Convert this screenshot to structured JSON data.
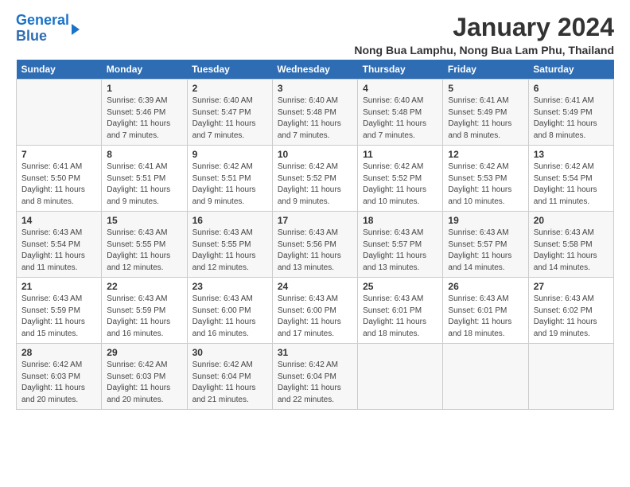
{
  "logo": {
    "line1": "General",
    "line2": "Blue"
  },
  "title": "January 2024",
  "location": "Nong Bua Lamphu, Nong Bua Lam Phu, Thailand",
  "weekdays": [
    "Sunday",
    "Monday",
    "Tuesday",
    "Wednesday",
    "Thursday",
    "Friday",
    "Saturday"
  ],
  "weeks": [
    [
      {
        "day": "",
        "info": ""
      },
      {
        "day": "1",
        "info": "Sunrise: 6:39 AM\nSunset: 5:46 PM\nDaylight: 11 hours\nand 7 minutes."
      },
      {
        "day": "2",
        "info": "Sunrise: 6:40 AM\nSunset: 5:47 PM\nDaylight: 11 hours\nand 7 minutes."
      },
      {
        "day": "3",
        "info": "Sunrise: 6:40 AM\nSunset: 5:48 PM\nDaylight: 11 hours\nand 7 minutes."
      },
      {
        "day": "4",
        "info": "Sunrise: 6:40 AM\nSunset: 5:48 PM\nDaylight: 11 hours\nand 7 minutes."
      },
      {
        "day": "5",
        "info": "Sunrise: 6:41 AM\nSunset: 5:49 PM\nDaylight: 11 hours\nand 8 minutes."
      },
      {
        "day": "6",
        "info": "Sunrise: 6:41 AM\nSunset: 5:49 PM\nDaylight: 11 hours\nand 8 minutes."
      }
    ],
    [
      {
        "day": "7",
        "info": "Sunrise: 6:41 AM\nSunset: 5:50 PM\nDaylight: 11 hours\nand 8 minutes."
      },
      {
        "day": "8",
        "info": "Sunrise: 6:41 AM\nSunset: 5:51 PM\nDaylight: 11 hours\nand 9 minutes."
      },
      {
        "day": "9",
        "info": "Sunrise: 6:42 AM\nSunset: 5:51 PM\nDaylight: 11 hours\nand 9 minutes."
      },
      {
        "day": "10",
        "info": "Sunrise: 6:42 AM\nSunset: 5:52 PM\nDaylight: 11 hours\nand 9 minutes."
      },
      {
        "day": "11",
        "info": "Sunrise: 6:42 AM\nSunset: 5:52 PM\nDaylight: 11 hours\nand 10 minutes."
      },
      {
        "day": "12",
        "info": "Sunrise: 6:42 AM\nSunset: 5:53 PM\nDaylight: 11 hours\nand 10 minutes."
      },
      {
        "day": "13",
        "info": "Sunrise: 6:42 AM\nSunset: 5:54 PM\nDaylight: 11 hours\nand 11 minutes."
      }
    ],
    [
      {
        "day": "14",
        "info": "Sunrise: 6:43 AM\nSunset: 5:54 PM\nDaylight: 11 hours\nand 11 minutes."
      },
      {
        "day": "15",
        "info": "Sunrise: 6:43 AM\nSunset: 5:55 PM\nDaylight: 11 hours\nand 12 minutes."
      },
      {
        "day": "16",
        "info": "Sunrise: 6:43 AM\nSunset: 5:55 PM\nDaylight: 11 hours\nand 12 minutes."
      },
      {
        "day": "17",
        "info": "Sunrise: 6:43 AM\nSunset: 5:56 PM\nDaylight: 11 hours\nand 13 minutes."
      },
      {
        "day": "18",
        "info": "Sunrise: 6:43 AM\nSunset: 5:57 PM\nDaylight: 11 hours\nand 13 minutes."
      },
      {
        "day": "19",
        "info": "Sunrise: 6:43 AM\nSunset: 5:57 PM\nDaylight: 11 hours\nand 14 minutes."
      },
      {
        "day": "20",
        "info": "Sunrise: 6:43 AM\nSunset: 5:58 PM\nDaylight: 11 hours\nand 14 minutes."
      }
    ],
    [
      {
        "day": "21",
        "info": "Sunrise: 6:43 AM\nSunset: 5:59 PM\nDaylight: 11 hours\nand 15 minutes."
      },
      {
        "day": "22",
        "info": "Sunrise: 6:43 AM\nSunset: 5:59 PM\nDaylight: 11 hours\nand 16 minutes."
      },
      {
        "day": "23",
        "info": "Sunrise: 6:43 AM\nSunset: 6:00 PM\nDaylight: 11 hours\nand 16 minutes."
      },
      {
        "day": "24",
        "info": "Sunrise: 6:43 AM\nSunset: 6:00 PM\nDaylight: 11 hours\nand 17 minutes."
      },
      {
        "day": "25",
        "info": "Sunrise: 6:43 AM\nSunset: 6:01 PM\nDaylight: 11 hours\nand 18 minutes."
      },
      {
        "day": "26",
        "info": "Sunrise: 6:43 AM\nSunset: 6:01 PM\nDaylight: 11 hours\nand 18 minutes."
      },
      {
        "day": "27",
        "info": "Sunrise: 6:43 AM\nSunset: 6:02 PM\nDaylight: 11 hours\nand 19 minutes."
      }
    ],
    [
      {
        "day": "28",
        "info": "Sunrise: 6:42 AM\nSunset: 6:03 PM\nDaylight: 11 hours\nand 20 minutes."
      },
      {
        "day": "29",
        "info": "Sunrise: 6:42 AM\nSunset: 6:03 PM\nDaylight: 11 hours\nand 20 minutes."
      },
      {
        "day": "30",
        "info": "Sunrise: 6:42 AM\nSunset: 6:04 PM\nDaylight: 11 hours\nand 21 minutes."
      },
      {
        "day": "31",
        "info": "Sunrise: 6:42 AM\nSunset: 6:04 PM\nDaylight: 11 hours\nand 22 minutes."
      },
      {
        "day": "",
        "info": ""
      },
      {
        "day": "",
        "info": ""
      },
      {
        "day": "",
        "info": ""
      }
    ]
  ]
}
